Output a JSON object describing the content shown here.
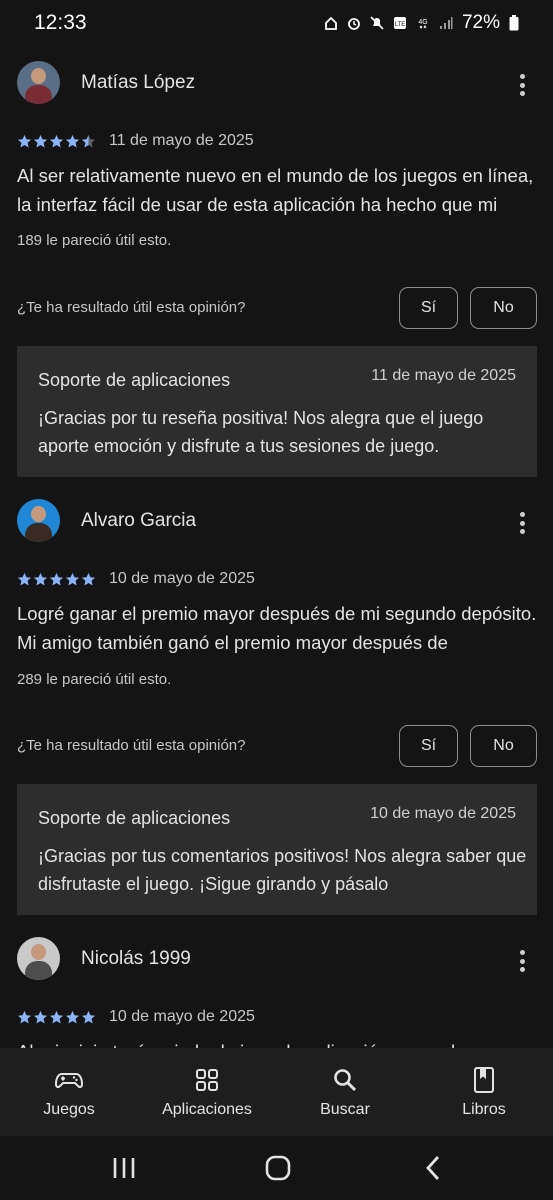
{
  "status_bar": {
    "time": "12:33",
    "battery": "72%",
    "icons": [
      "home-icon",
      "alarm-icon",
      "mute-icon",
      "volte-icon",
      "4g-icon",
      "signal-icon",
      "battery-icon"
    ]
  },
  "reviews": [
    {
      "name": "Matías López",
      "rating": 4.5,
      "date": "11 de mayo de 2025",
      "text": "Al ser relativamente nuevo en el mundo de los juegos en línea, la interfaz fácil de usar de esta aplicación ha hecho que mi",
      "helpful": "189 le pareció útil esto.",
      "question": "¿Te ha resultado útil esta opinión?",
      "yes": "Sí",
      "no": "No",
      "reply": {
        "from": "Soporte de aplicaciones",
        "date": "11 de mayo de 2025",
        "text": "¡Gracias por tu reseña positiva! Nos alegra que el juego aporte emoción y disfrute a tus sesiones de juego."
      }
    },
    {
      "name": "Alvaro Garcia",
      "rating": 5,
      "date": "10 de mayo de 2025",
      "text": "Logré ganar el premio mayor después de mi segundo depósito. Mi amigo también ganó el premio mayor después de",
      "helpful": "289 le pareció útil esto.",
      "question": "¿Te ha resultado útil esta opinión?",
      "yes": "Sí",
      "no": "No",
      "reply": {
        "from": "Soporte de aplicaciones",
        "date": "10 de mayo de 2025",
        "text": "¡Gracias por tus comentarios positivos! Nos alegra saber que disfrutaste el juego. ¡Sigue girando y pásalo"
      }
    },
    {
      "name": "Nicolás 1999",
      "rating": 5,
      "date": "10 de mayo de 2025",
      "text": "Al principio tenía miedo de jugar la aplicación, pero ahora"
    }
  ],
  "bottom_nav": [
    {
      "label": "Juegos",
      "icon": "gamepad-icon"
    },
    {
      "label": "Aplicaciones",
      "icon": "apps-grid-icon"
    },
    {
      "label": "Buscar",
      "icon": "search-icon"
    },
    {
      "label": "Libros",
      "icon": "book-icon"
    }
  ],
  "colors": {
    "background": "#141414",
    "reply_background": "#2d2d2d",
    "star": "#8ab4f8",
    "nav_background": "#1e1e1e"
  }
}
